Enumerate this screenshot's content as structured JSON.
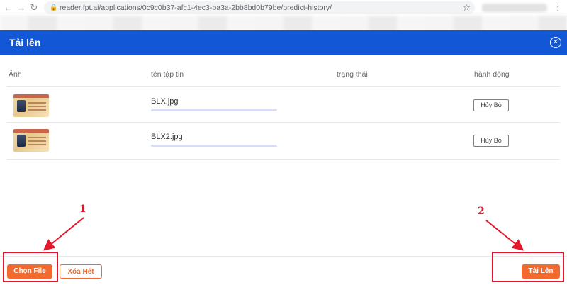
{
  "browser": {
    "url": "reader.fpt.ai/applications/0c9c0b37-afc1-4ec3-ba3a-2bb8bd0b79be/predict-history/",
    "icons": [
      "back-arrow-icon",
      "forward-arrow-icon",
      "reload-icon",
      "lock-icon",
      "star-icon",
      "menu-dots-icon"
    ]
  },
  "modal": {
    "title": "Tải lên",
    "close_icon": "close-circle-icon"
  },
  "table": {
    "columns": [
      "Ảnh",
      "tên tập tin",
      "trạng thái",
      "hành động"
    ],
    "rows": [
      {
        "filename": "BLX.jpg",
        "status": "",
        "action": "Hủy Bỏ",
        "progress": 0
      },
      {
        "filename": "BLX2.jpg",
        "status": "",
        "action": "Hủy Bỏ",
        "progress": 0
      }
    ]
  },
  "footer": {
    "choose_file": "Chọn File",
    "clear_all": "Xóa Hết",
    "upload": "Tải Lên"
  },
  "annotations": {
    "label_1": "1",
    "label_2": "2",
    "color": "#e4162b"
  },
  "colors": {
    "header_blue": "#1257d6",
    "accent_orange": "#f26a2e"
  }
}
